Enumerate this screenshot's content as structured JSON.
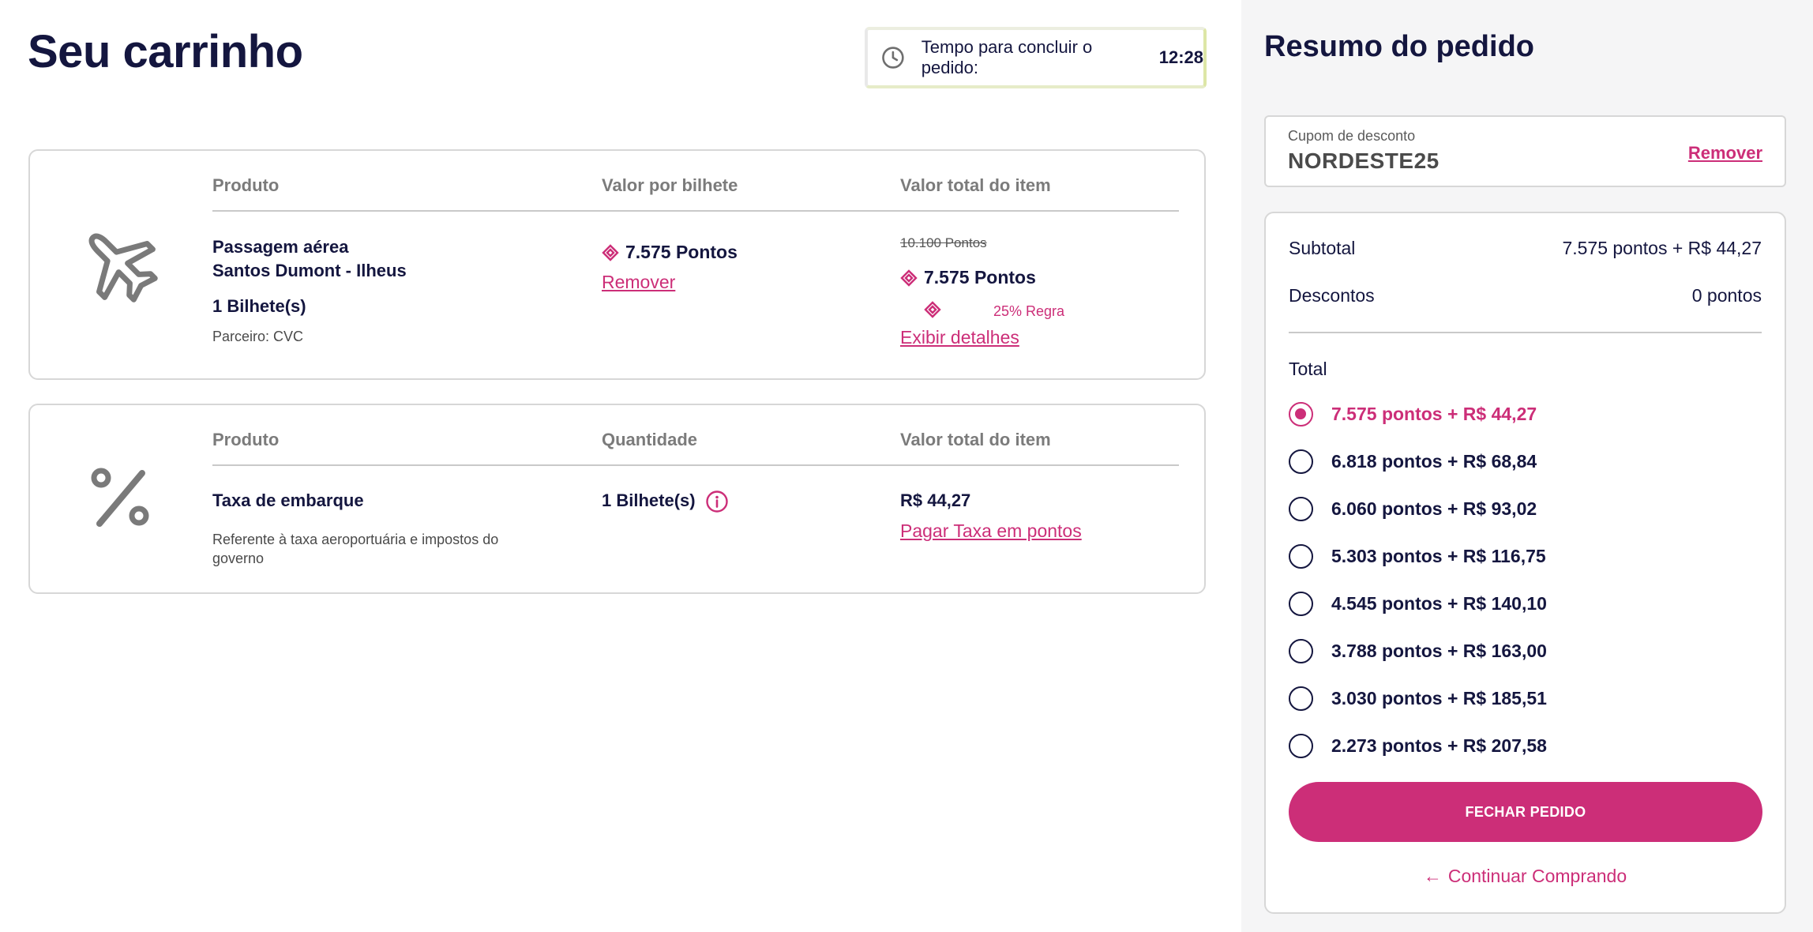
{
  "page": {
    "title": "Seu carrinho"
  },
  "timer": {
    "label": "Tempo para concluir o pedido:",
    "value": "12:28"
  },
  "item1": {
    "head_produto": "Produto",
    "head_valor_bilhete": "Valor por bilhete",
    "head_valor_total": "Valor total do item",
    "name_line1": "Passagem aérea",
    "name_line2": "Santos Dumont - Ilheus",
    "tickets": "1 Bilhete(s)",
    "partner": "Parceiro: CVC",
    "unit_points": "7.575 Pontos",
    "remove": "Remover",
    "old_total": "10.100 Pontos",
    "total_points": "7.575 Pontos",
    "rule": "25% Regra",
    "details": "Exibir detalhes"
  },
  "item2": {
    "head_produto": "Produto",
    "head_quantidade": "Quantidade",
    "head_valor_total": "Valor total do item",
    "name": "Taxa de embarque",
    "description": "Referente à taxa aeroportuária e impostos do governo",
    "quantity": "1 Bilhete(s)",
    "total": "R$ 44,27",
    "pay_link": "Pagar Taxa em pontos"
  },
  "summary": {
    "title": "Resumo do pedido",
    "coupon_label": "Cupom de desconto",
    "coupon_value": "NORDESTE25",
    "coupon_remove": "Remover",
    "subtotal_label": "Subtotal",
    "subtotal_value": "7.575 pontos + R$ 44,27",
    "discount_label": "Descontos",
    "discount_value": "0 pontos",
    "total_label": "Total",
    "options": [
      {
        "text": "7.575 pontos + R$ 44,27",
        "selected": true
      },
      {
        "text": "6.818 pontos + R$ 68,84",
        "selected": false
      },
      {
        "text": "6.060 pontos + R$ 93,02",
        "selected": false
      },
      {
        "text": "5.303 pontos + R$ 116,75",
        "selected": false
      },
      {
        "text": "4.545 pontos + R$ 140,10",
        "selected": false
      },
      {
        "text": "3.788 pontos + R$ 163,00",
        "selected": false
      },
      {
        "text": "3.030 pontos + R$ 185,51",
        "selected": false
      },
      {
        "text": "2.273 pontos + R$ 207,58",
        "selected": false
      }
    ],
    "checkout_button": "FECHAR PEDIDO",
    "continue_link": "Continuar Comprando"
  },
  "colors": {
    "accent": "#cc2e78",
    "navy": "#14163f",
    "timer_border": "#dde6a6"
  }
}
